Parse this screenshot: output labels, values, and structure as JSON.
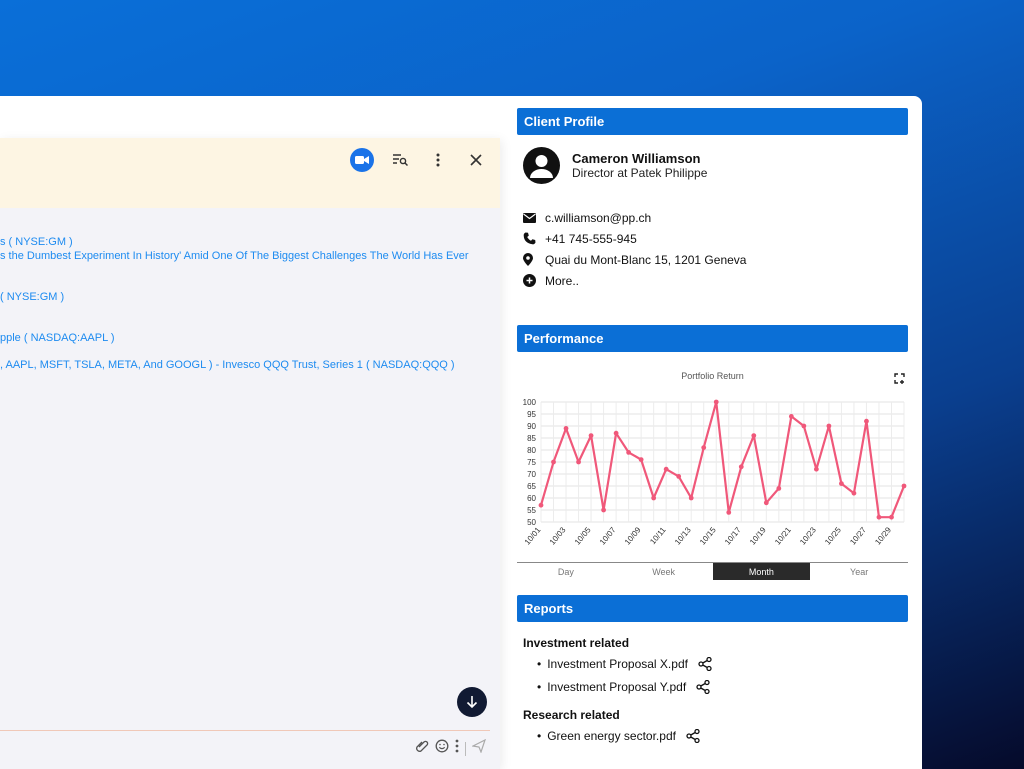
{
  "chat": {
    "messages": [
      "s ( NYSE:GM )",
      "s the Dumbest Experiment In History' Amid One Of The Biggest Challenges The World Has Ever",
      "( NYSE:GM )",
      "pple ( NASDAQ:AAPL )",
      ", AAPL, MSFT, TSLA, META, And GOOGL ) - Invesco QQQ Trust, Series 1 ( NASDAQ:QQQ )"
    ],
    "icons": [
      "video-icon",
      "search-list-icon",
      "more-vert-icon",
      "close-icon"
    ]
  },
  "profile": {
    "header": "Client Profile",
    "name": "Cameron Williamson",
    "role": "Director at Patek Philippe",
    "email": "c.williamson@pp.ch",
    "phone": "+41 745-555-945",
    "address": "Quai du Mont-Blanc 15, 1201 Geneva",
    "more": "More.."
  },
  "performance": {
    "header": "Performance",
    "tabs": [
      "Day",
      "Week",
      "Month",
      "Year"
    ],
    "active_tab": "Month"
  },
  "chart_data": {
    "type": "line",
    "title": "Portfolio Return",
    "ylim": [
      50,
      100
    ],
    "yticks": [
      100,
      95,
      90,
      85,
      80,
      75,
      70,
      65,
      60,
      55,
      50
    ],
    "x": [
      "10/01",
      "10/02",
      "10/03",
      "10/04",
      "10/05",
      "10/06",
      "10/07",
      "10/08",
      "10/09",
      "10/10",
      "10/11",
      "10/12",
      "10/13",
      "10/14",
      "10/15",
      "10/16",
      "10/17",
      "10/18",
      "10/19",
      "10/20",
      "10/21",
      "10/22",
      "10/23",
      "10/24",
      "10/25",
      "10/26",
      "10/27",
      "10/28",
      "10/29",
      "10/30"
    ],
    "xtick_labels": [
      "10/01",
      "10/03",
      "10/05",
      "10/07",
      "10/09",
      "10/11",
      "10/13",
      "10/15",
      "10/17",
      "10/19",
      "10/21",
      "10/23",
      "10/25",
      "10/27",
      "10/29"
    ],
    "series": [
      {
        "values": [
          57,
          75,
          89,
          75,
          86,
          55,
          87,
          79,
          76,
          60,
          72,
          69,
          60,
          81,
          100,
          54,
          73,
          86,
          58,
          64,
          94,
          90,
          72,
          90,
          66,
          62,
          92,
          52,
          52,
          65
        ],
        "color": "#f0587a"
      }
    ],
    "grid": true
  },
  "reports": {
    "header": "Reports",
    "groups": [
      {
        "title": "Investment related",
        "items": [
          "Investment Proposal X.pdf",
          "Investment Proposal Y.pdf"
        ]
      },
      {
        "title": "Research related",
        "items": [
          "Green energy sector.pdf"
        ]
      }
    ]
  }
}
